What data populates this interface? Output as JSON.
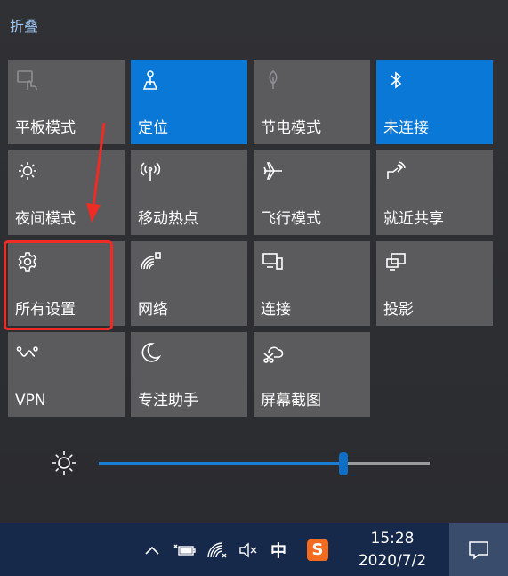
{
  "panel": {
    "collapse_label": "折叠"
  },
  "tiles": [
    {
      "label": "平板模式",
      "icon": "tablet-mode-icon",
      "state": "disabled"
    },
    {
      "label": "定位",
      "icon": "location-icon",
      "state": "active"
    },
    {
      "label": "节电模式",
      "icon": "battery-saver-icon",
      "state": "disabled"
    },
    {
      "label": "未连接",
      "icon": "bluetooth-icon",
      "state": "active"
    },
    {
      "label": "夜间模式",
      "icon": "night-light-icon",
      "state": "normal"
    },
    {
      "label": "移动热点",
      "icon": "mobile-hotspot-icon",
      "state": "normal"
    },
    {
      "label": "飞行模式",
      "icon": "airplane-icon",
      "state": "normal"
    },
    {
      "label": "就近共享",
      "icon": "nearby-share-icon",
      "state": "normal"
    },
    {
      "label": "所有设置",
      "icon": "settings-gear-icon",
      "state": "normal"
    },
    {
      "label": "网络",
      "icon": "network-icon",
      "state": "normal"
    },
    {
      "label": "连接",
      "icon": "connect-icon",
      "state": "normal"
    },
    {
      "label": "投影",
      "icon": "project-icon",
      "state": "normal"
    },
    {
      "label": "VPN",
      "icon": "vpn-icon",
      "state": "normal"
    },
    {
      "label": "专注助手",
      "icon": "focus-assist-icon",
      "state": "normal"
    },
    {
      "label": "屏幕截图",
      "icon": "screen-snip-icon",
      "state": "normal"
    }
  ],
  "brightness": {
    "icon": "brightness-icon",
    "level": 0.74
  },
  "annotation": {
    "color": "#ee2b24"
  },
  "colors": {
    "accent": "#0a78d7",
    "tile": "#5b5b5e",
    "taskbar": "#16294a"
  },
  "taskbar": {
    "tray_icons": [
      "chevron-up-icon",
      "power-battery-icon",
      "wifi-icon",
      "volume-muted-icon"
    ],
    "ime_label": "中",
    "ime_app_icon": "sogou-input-icon",
    "ime_app_glyph": "S",
    "time": "15:28",
    "date": "2020/7/2",
    "action_center_icon": "action-center-icon"
  }
}
